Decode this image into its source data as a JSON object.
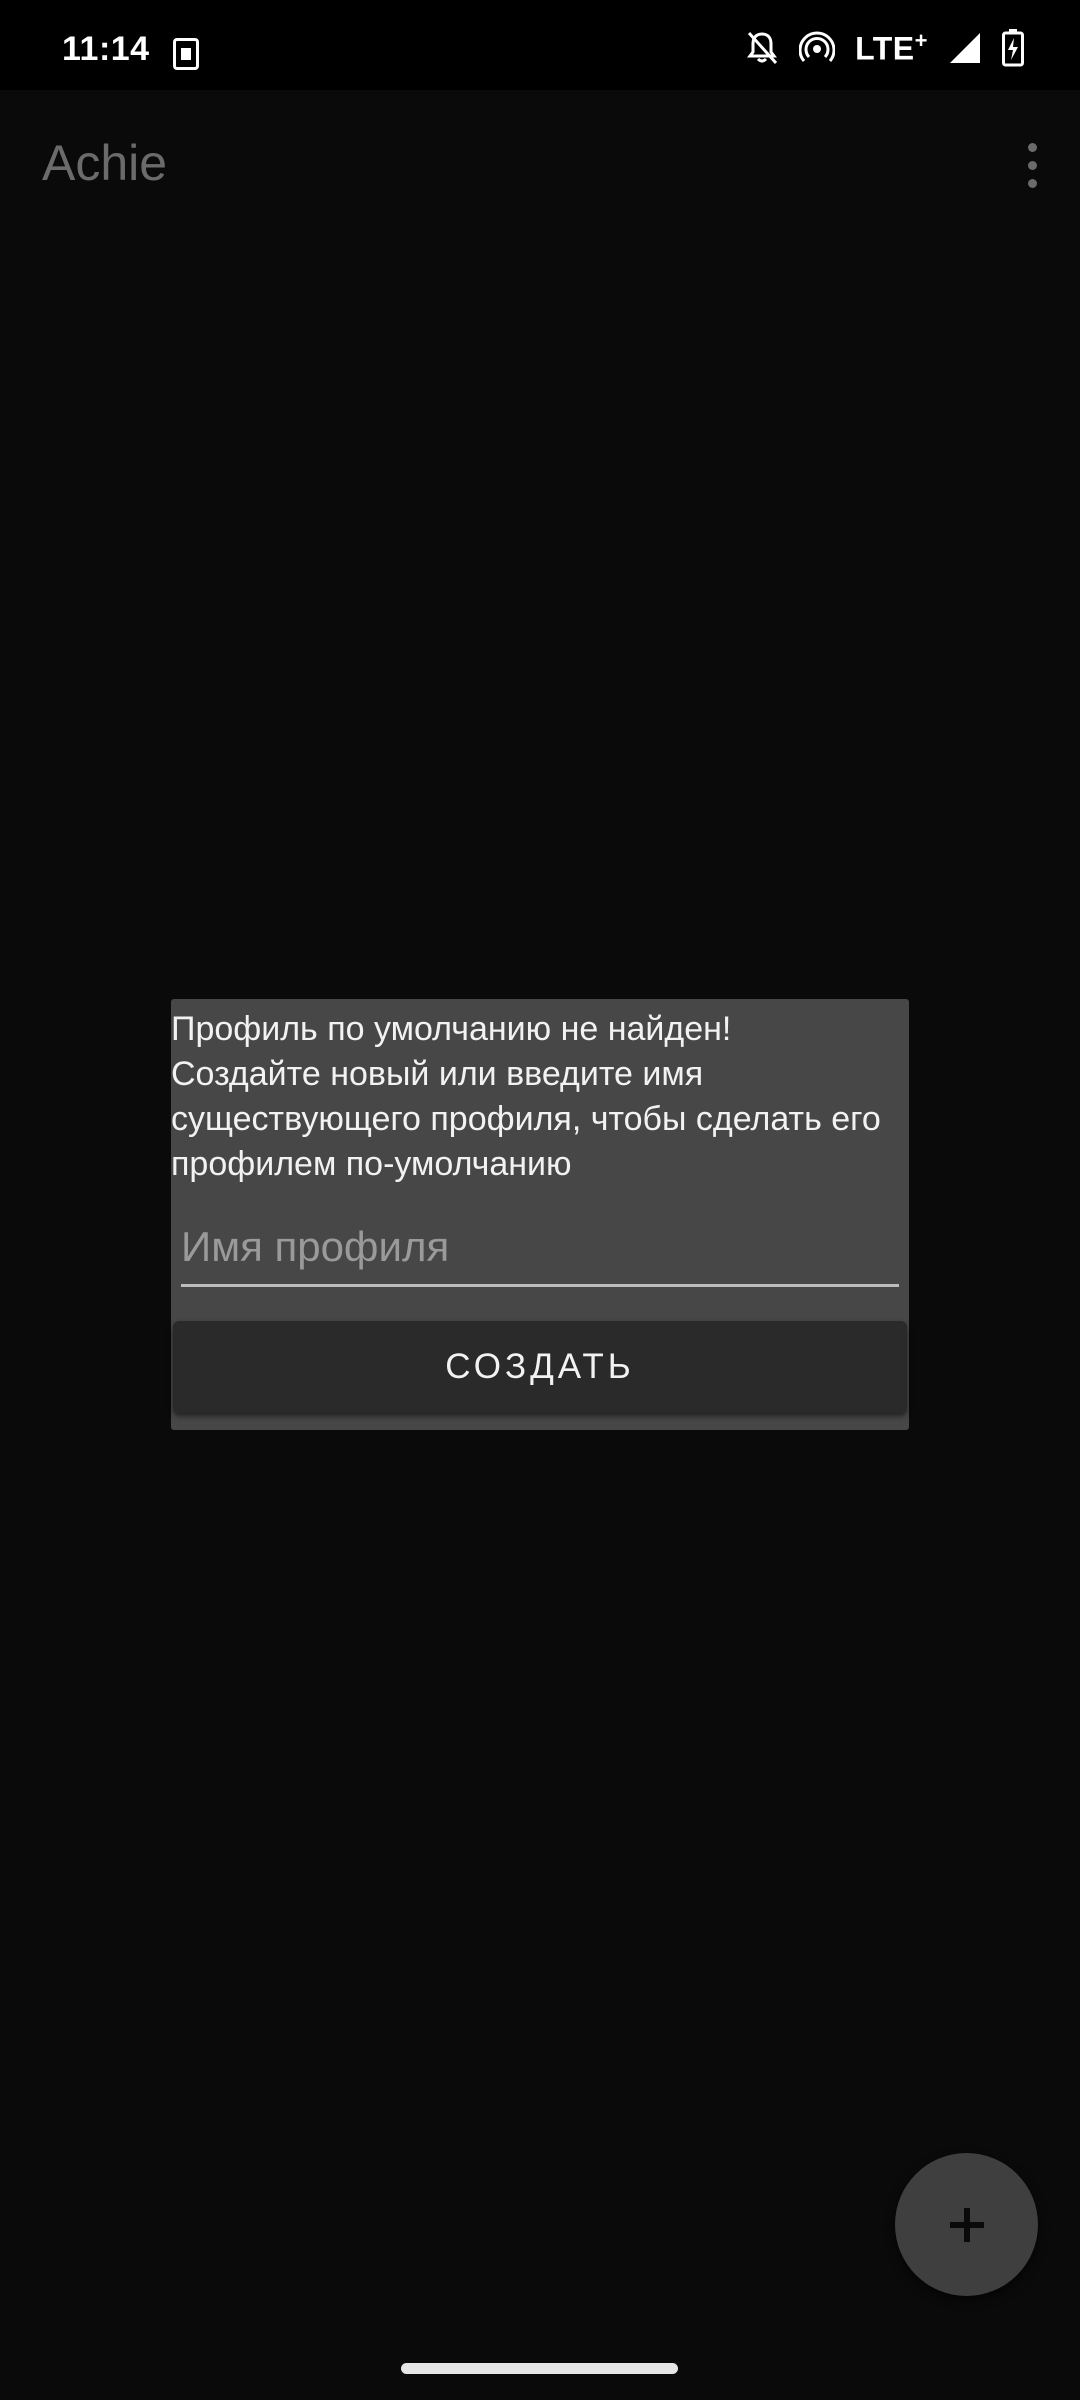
{
  "status_bar": {
    "time": "11:14",
    "network_label": "LTE",
    "network_suffix": "+",
    "icons": [
      "k-app-notification-icon",
      "notifications-off-icon",
      "hotspot-icon",
      "cellular-signal-icon",
      "battery-charging-icon"
    ]
  },
  "app_bar": {
    "title": "Achie",
    "overflow_icon": "more-vert-icon"
  },
  "dialog": {
    "message": "Профиль по умолчанию не найден!\nСоздайте новый или введите имя существующего профиля, чтобы сделать его профилем по-умолчанию",
    "input_placeholder": "Имя профиля",
    "input_value": "",
    "button_label": "СОЗДАТЬ"
  },
  "fab": {
    "icon": "plus-icon"
  },
  "colors": {
    "background": "#0a0a0a",
    "dialog": "#474747",
    "button": "#2a2a2a",
    "fab": "#3f3f3f",
    "title": "#6b6b6b"
  }
}
